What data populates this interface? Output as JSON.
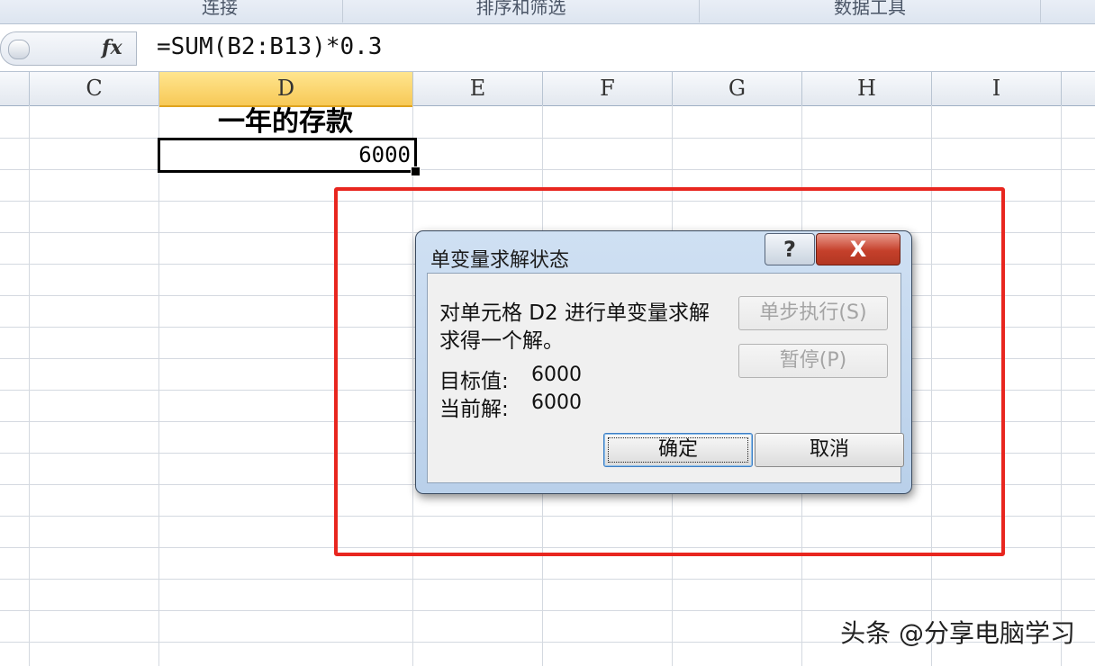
{
  "ribbon": {
    "groups": [
      "连接",
      "排序和筛选",
      "数据工具"
    ]
  },
  "formula_bar": {
    "fx_label": "fx",
    "formula": "=SUM(B2:B13)*0.3"
  },
  "columns": [
    "C",
    "D",
    "E",
    "F",
    "G",
    "H",
    "I"
  ],
  "active_column": "D",
  "sheet": {
    "d1_text": "一年的存款",
    "d2_value": "6000"
  },
  "dialog": {
    "title": "单变量求解状态",
    "help_label": "?",
    "close_label": "X",
    "message_line1": "对单元格 D2 进行单变量求解",
    "message_line2": "求得一个解。",
    "target_label": "目标值:",
    "target_value": "6000",
    "current_label": "当前解:",
    "current_value": "6000",
    "step_button": "单步执行(S)",
    "pause_button": "暂停(P)",
    "ok_button": "确定",
    "cancel_button": "取消"
  },
  "watermark": "头条 @分享电脑学习",
  "colors": {
    "highlight_box": "#e8261f",
    "active_header": "#f7c957"
  }
}
